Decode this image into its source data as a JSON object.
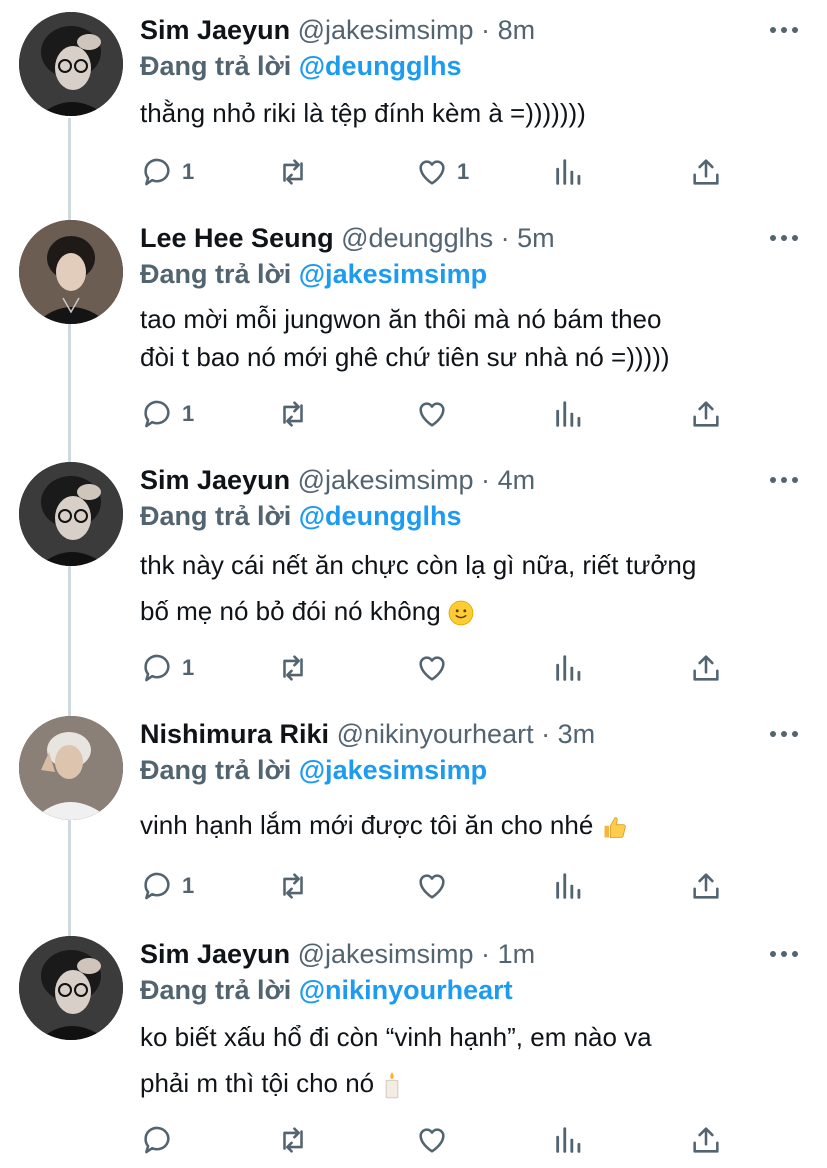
{
  "replying_prefix": "Đang trả lời",
  "tweets": [
    {
      "name": "Sim Jaeyun",
      "handle": "@jakesimsimp",
      "sep": "·",
      "time": "8m",
      "reply_to": "@deungglhs",
      "lines": [
        "thằng nhỏ riki là tệp đính kèm à =)))))))"
      ],
      "reply_count": "1",
      "like_count": "1",
      "avatar_icon": "avatar-icon"
    },
    {
      "name": "Lee Hee Seung",
      "handle": "@deungglhs",
      "sep": "·",
      "time": "5m",
      "reply_to": "@jakesimsimp",
      "lines": [
        "tao mời mỗi jungwon ăn thôi mà nó bám theo",
        "đòi t bao nó mới ghê chứ tiên sư nhà nó =)))))"
      ],
      "reply_count": "1",
      "like_count": "",
      "avatar_icon": "avatar-icon"
    },
    {
      "name": "Sim Jaeyun",
      "handle": "@jakesimsimp",
      "sep": "·",
      "time": "4m",
      "reply_to": "@deungglhs",
      "lines": [
        "thk này cái nết ăn chực còn lạ gì nữa, riết tưởng",
        "bố mẹ nó bỏ đói nó không"
      ],
      "reply_count": "1",
      "like_count": "",
      "avatar_icon": "avatar-icon"
    },
    {
      "name": "Nishimura Riki",
      "handle": "@nikinyourheart",
      "sep": "·",
      "time": "3m",
      "reply_to": "@jakesimsimp",
      "lines": [
        "vinh hạnh lắm mới được tôi ăn cho nhé"
      ],
      "reply_count": "1",
      "like_count": "",
      "avatar_icon": "avatar-icon"
    },
    {
      "name": "Sim Jaeyun",
      "handle": "@jakesimsimp",
      "sep": "·",
      "time": "1m",
      "reply_to": "@nikinyourheart",
      "lines": [
        "ko biết xấu hổ đi còn “vinh hạnh”, em nào va",
        "phải m thì tội cho nó"
      ],
      "reply_count": "",
      "like_count": "",
      "avatar_icon": "avatar-icon"
    }
  ],
  "colors": {
    "link": "#1d9bf0",
    "secondary": "#536471",
    "thread_line": "#cfd9de"
  }
}
